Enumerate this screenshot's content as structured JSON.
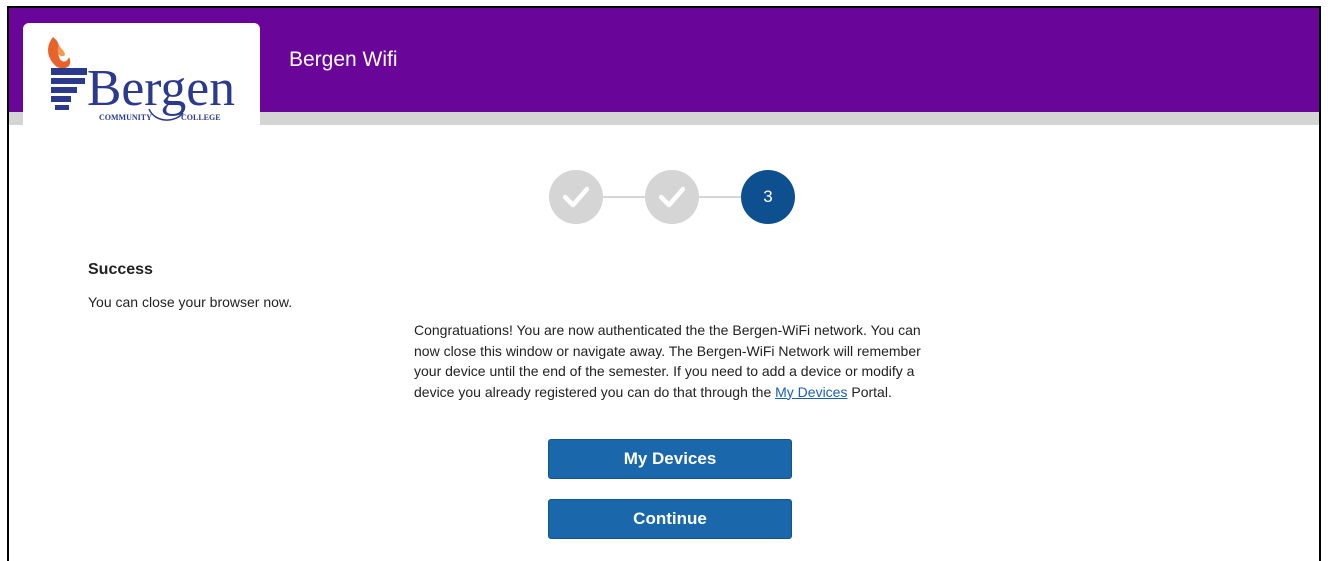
{
  "header": {
    "title": "Bergen Wifi",
    "logo": {
      "wordmark": "Bergen",
      "tagline_left": "COMMUNITY",
      "tagline_right": "COLLEGE"
    }
  },
  "progress": {
    "steps": [
      {
        "state": "complete",
        "icon": "checkmark-icon"
      },
      {
        "state": "complete",
        "icon": "checkmark-icon"
      },
      {
        "state": "current",
        "label": "3"
      }
    ]
  },
  "status": {
    "title": "Success",
    "subtitle": "You can close your browser now."
  },
  "message": {
    "text_before_link": "Congratuations! You are now authenticated the the Bergen-WiFi network.  You can now close this window or navigate away.  The Bergen-WiFi Network will remember your device until the end of the semester.  If you need to add a device or modify a device you already registered you can do that through the ",
    "link_text": "My Devices",
    "text_after_link": " Portal."
  },
  "buttons": {
    "my_devices": "My Devices",
    "continue": "Continue"
  },
  "colors": {
    "header_purple": "#6a0599",
    "primary_blue": "#1a67ac",
    "step_current": "#0e4f8f",
    "step_done": "#d5d5d5",
    "logo_navy": "#2b3a8c",
    "logo_flame": "#e8622c"
  }
}
